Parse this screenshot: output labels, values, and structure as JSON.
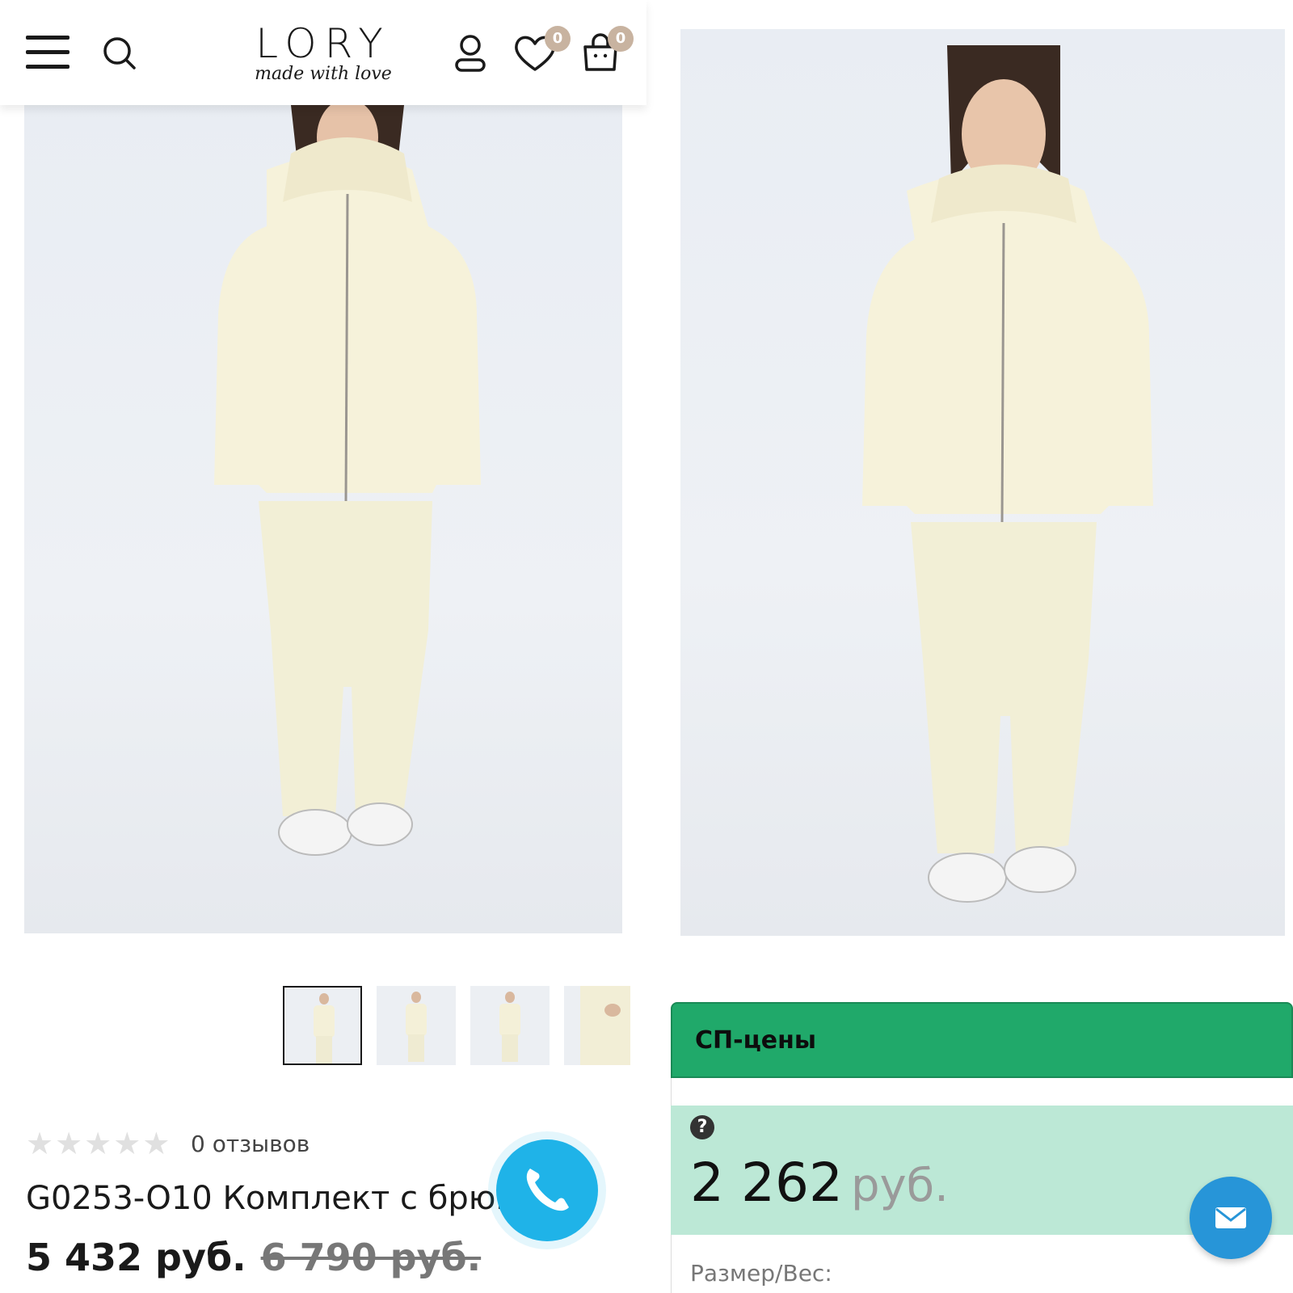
{
  "header": {
    "logo_main": "LORY",
    "logo_tagline": "made with love",
    "wishlist_count": "0",
    "cart_count": "0"
  },
  "product": {
    "reviews_text": "0 отзывов",
    "rating_stars": 0,
    "rating_max": 5,
    "title": "G0253-O10 Комплект с брюками",
    "price": "5 432 руб.",
    "old_price": "6 790 руб.",
    "thumbnail_count": 4,
    "active_thumbnail": 1
  },
  "sp_prices": {
    "header": "СП-цены",
    "help_icon": "?",
    "price_value": "2 262",
    "currency": "руб.",
    "size_label": "Размер/Вес:"
  },
  "colors": {
    "green_header": "#20a96a",
    "mint_price": "#bce8d6",
    "call_button": "#1fb3e8",
    "mail_button": "#2795d8",
    "badge": "#c8b3a0"
  }
}
